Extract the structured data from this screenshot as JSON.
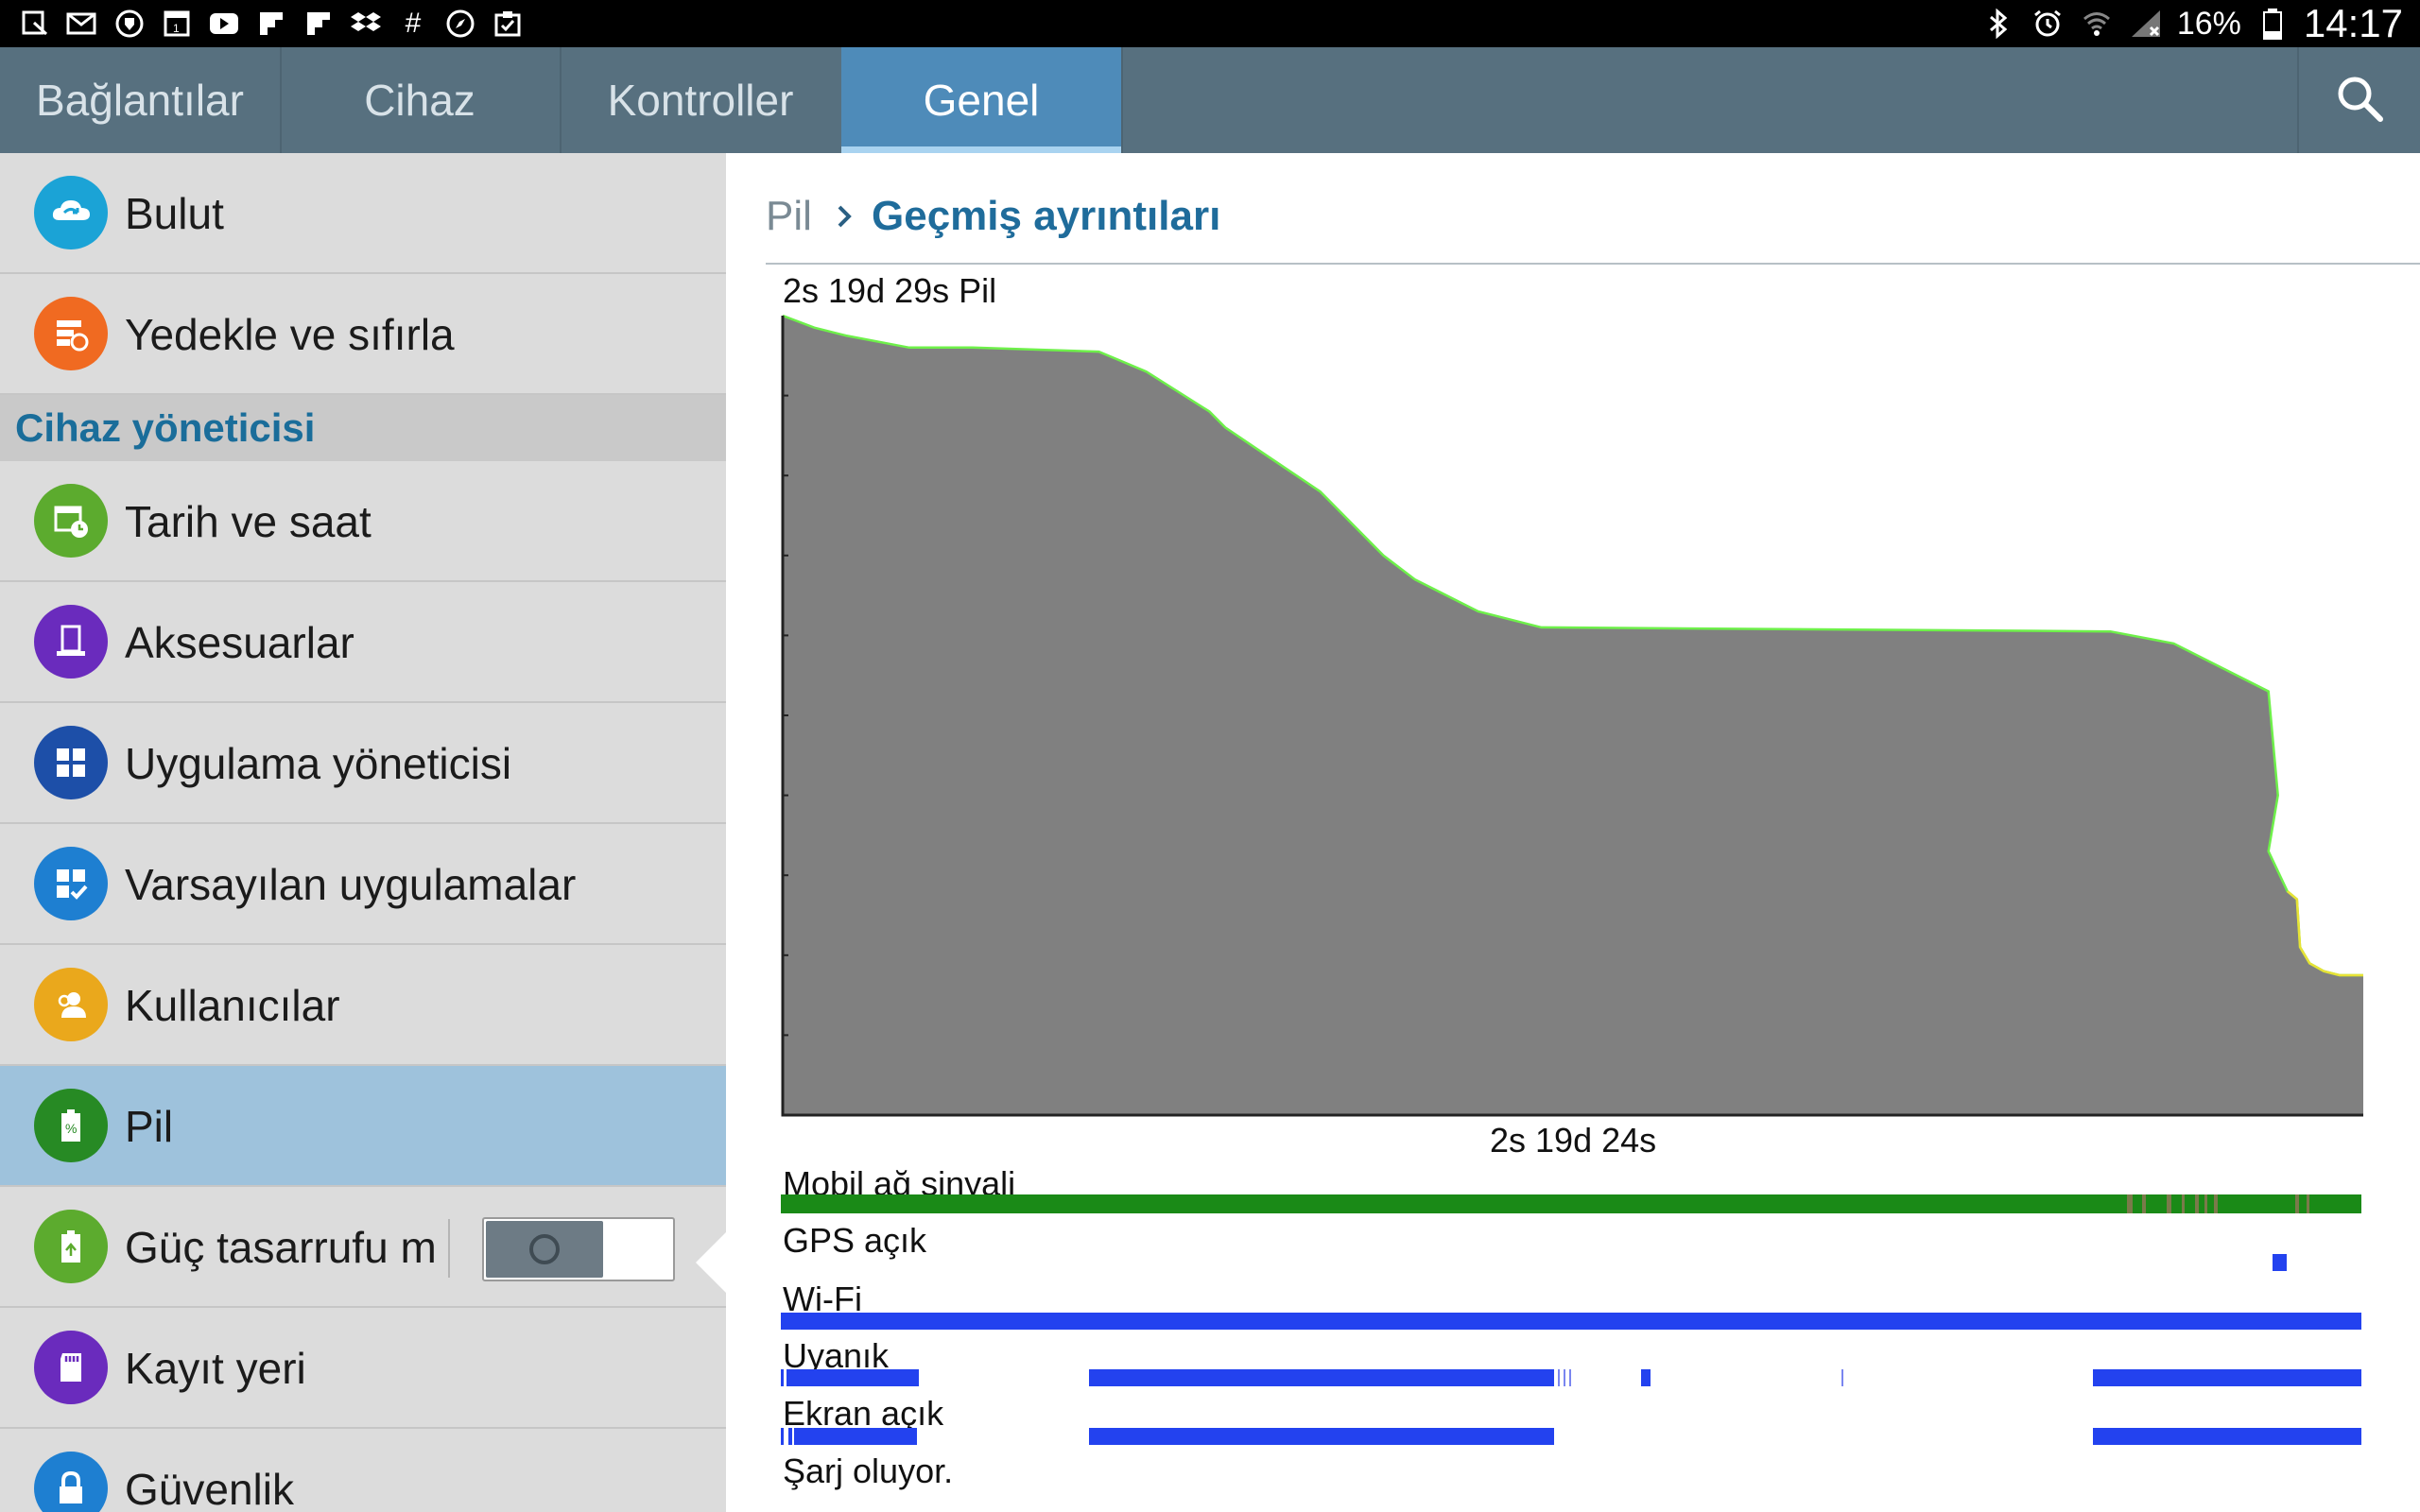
{
  "status_bar": {
    "left_icons": [
      "notification-icon",
      "mail-icon",
      "shield-icon",
      "calendar-icon",
      "youtube-icon",
      "flipboard-icon",
      "flipboard-icon",
      "dropbox-icon",
      "hash-icon",
      "compass-icon",
      "clipboard-icon"
    ],
    "right_icons": [
      "bluetooth-icon",
      "alarm-icon",
      "wifi-icon",
      "signal-icon",
      "battery-icon"
    ],
    "battery": "16%",
    "clock": "14:17"
  },
  "tabs": [
    {
      "label": "Bağlantılar",
      "active": false
    },
    {
      "label": "Cihaz",
      "active": false
    },
    {
      "label": "Kontroller",
      "active": false
    },
    {
      "label": "Genel",
      "active": true
    }
  ],
  "sidebar": {
    "items_top": [
      {
        "label": "Bulut",
        "icon": "cloud-icon",
        "color": "#1ba3d6"
      },
      {
        "label": "Yedekle ve sıfırla",
        "icon": "backup-icon",
        "color": "#f06a21"
      }
    ],
    "section": "Cihaz yöneticisi",
    "items": [
      {
        "label": "Tarih ve saat",
        "icon": "calendar-clock-icon",
        "color": "#5cab2e"
      },
      {
        "label": "Aksesuarlar",
        "icon": "accessory-icon",
        "color": "#6a2bbd"
      },
      {
        "label": "Uygulama yöneticisi",
        "icon": "app-grid-icon",
        "color": "#1d4fa8"
      },
      {
        "label": "Varsayılan uygulamalar",
        "icon": "default-apps-icon",
        "color": "#1e7fd1"
      },
      {
        "label": "Kullanıcılar",
        "icon": "users-icon",
        "color": "#eaa81c"
      },
      {
        "label": "Pil",
        "icon": "battery-icon",
        "color": "#278a24",
        "selected": true
      },
      {
        "label": "Güç tasarrufu modu",
        "icon": "power-saving-icon",
        "color": "#5cab2e",
        "toggle": true,
        "toggle_on": false
      },
      {
        "label": "Kayıt yeri",
        "icon": "sd-card-icon",
        "color": "#6a2bbd"
      },
      {
        "label": "Güvenlik",
        "icon": "lock-icon",
        "color": "#1e7fd1"
      }
    ]
  },
  "content": {
    "breadcrumb_root": "Pil",
    "breadcrumb_current": "Geçmiş ayrıntıları",
    "duration_label": "2s 19d 29s Pil",
    "x_label": "2s 19d 24s",
    "colors": {
      "fill": "#808080",
      "line": "#6ef04a",
      "track_green": "#1a8a17",
      "track_blue": "#2342ef"
    },
    "tracks": [
      {
        "label": "Mobil ağ sinyali"
      },
      {
        "label": "GPS açık"
      },
      {
        "label": "Wi-Fi"
      },
      {
        "label": "Uyanık"
      },
      {
        "label": "Ekran açık"
      },
      {
        "label": "Şarj oluyor."
      }
    ]
  },
  "chart_data": {
    "type": "area",
    "title": "2s 19d 29s Pil",
    "xlabel": "2s 19d 24s",
    "ylabel": "",
    "x": [
      0,
      0.02,
      0.04,
      0.08,
      0.12,
      0.2,
      0.23,
      0.27,
      0.28,
      0.31,
      0.34,
      0.38,
      0.4,
      0.44,
      0.48,
      0.84,
      0.88,
      0.94,
      0.946,
      0.94,
      0.952,
      0.958,
      0.96,
      0.966,
      0.975,
      0.985,
      1.0
    ],
    "y": [
      100,
      98.5,
      97.5,
      96,
      96,
      95.5,
      93,
      88,
      86,
      82,
      78,
      70,
      67,
      63,
      61,
      60.5,
      59,
      53,
      40,
      33,
      28,
      27,
      21,
      19,
      18,
      17.5,
      17.5
    ],
    "ylim": [
      0,
      100
    ],
    "grid": false
  }
}
